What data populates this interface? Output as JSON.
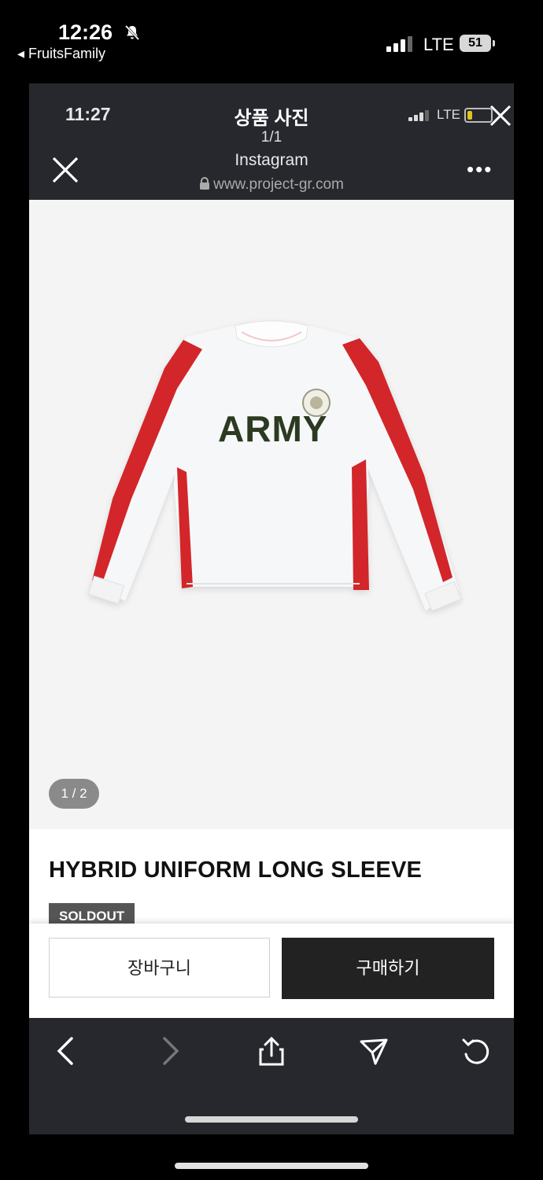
{
  "outer_status": {
    "time": "12:26",
    "back_app": "◂ FruitsFamily",
    "network": "LTE",
    "battery": "51"
  },
  "inner_status": {
    "time": "11:27",
    "network": "LTE"
  },
  "viewer": {
    "title": "상품 사진",
    "count": "1/1",
    "source": "Instagram",
    "url": "www.project-gr.com"
  },
  "product": {
    "image_counter": "1 / 2",
    "shirt_print": "ARMY",
    "title": "HYBRID UNIFORM LONG SLEEVE",
    "badge": "SOLDOUT",
    "cart_label": "장바구니",
    "buy_label": "구매하기"
  },
  "colors": {
    "header_bg": "#26282d",
    "shirt_red": "#d2272b",
    "print_green": "#2b3a20"
  }
}
